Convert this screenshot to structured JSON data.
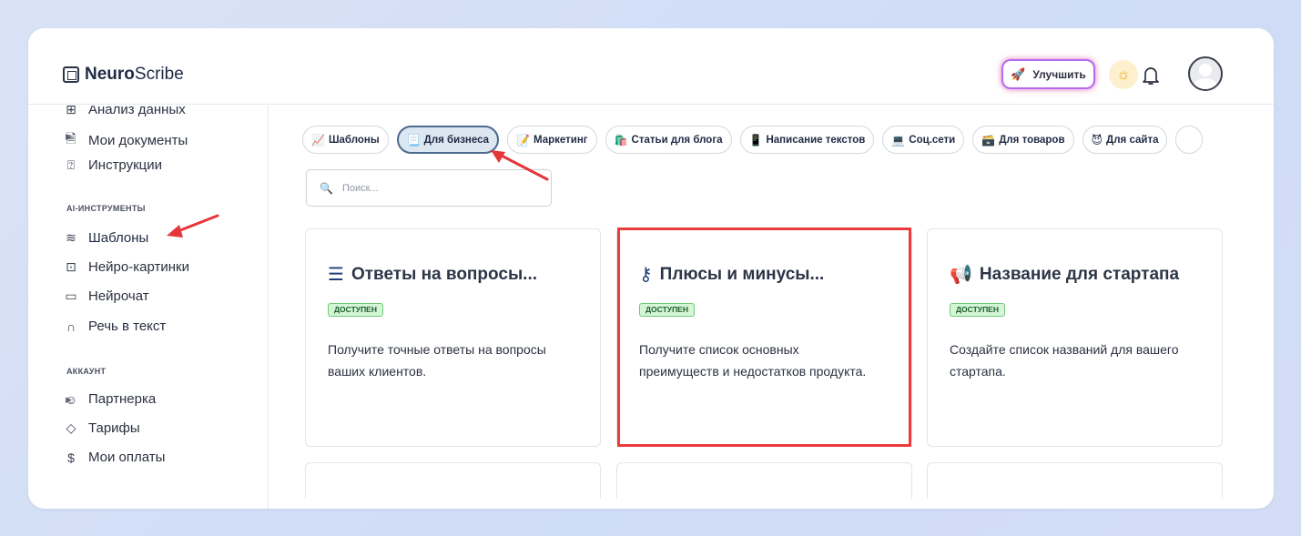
{
  "app": {
    "logo_bold": "Neuro",
    "logo_rest": "Scribe"
  },
  "header": {
    "upgrade_label": "Улучшить"
  },
  "sidebar": {
    "items_top": [
      {
        "label": "Анализ данных",
        "icon": "grid-icon"
      },
      {
        "label": "Мои документы",
        "icon": "document-icon"
      },
      {
        "label": "Инструкции",
        "icon": "help-circle-icon"
      }
    ],
    "section_ai": "AI-ИНСТРУМЕНТЫ",
    "items_ai": [
      {
        "label": "Шаблоны",
        "icon": "layers-icon"
      },
      {
        "label": "Нейро-картинки",
        "icon": "image-icon"
      },
      {
        "label": "Нейрочат",
        "icon": "chat-icon"
      },
      {
        "label": "Речь в текст",
        "icon": "headphones-icon"
      }
    ],
    "section_account": "АККАУНТ",
    "items_account": [
      {
        "label": "Партнерка",
        "icon": "users-icon"
      },
      {
        "label": "Тарифы",
        "icon": "tag-icon"
      },
      {
        "label": "Мои оплаты",
        "icon": "dollar-icon"
      }
    ]
  },
  "tabs": [
    {
      "label": "Шаблоны",
      "emoji": "📈"
    },
    {
      "label": "Для бизнеса",
      "emoji": "📃"
    },
    {
      "label": "Маркетинг",
      "emoji": "📝"
    },
    {
      "label": "Статьи для блога",
      "emoji": "🛍️"
    },
    {
      "label": "Написание текстов",
      "emoji": "📱"
    },
    {
      "label": "Соц.сети",
      "emoji": "💻"
    },
    {
      "label": "Для товаров",
      "emoji": "🗃️"
    },
    {
      "label": "Для сайта",
      "emoji": "😈"
    }
  ],
  "search": {
    "placeholder": "Поиск..."
  },
  "cards": [
    {
      "title": "Ответы на вопросы...",
      "icon": "list-icon",
      "badge": "ДОСТУПЕН",
      "description": "Получите точные ответы на вопросы ваших клиентов."
    },
    {
      "title": "Плюсы и минусы...",
      "icon": "key-icon",
      "badge": "ДОСТУПЕН",
      "description": "Получите список основных преимуществ и недостатков продукта."
    },
    {
      "title": "Название для стартапа",
      "icon": "megaphone-icon",
      "badge": "ДОСТУПЕН",
      "description": "Создайте список названий для вашего стартапа."
    }
  ],
  "colors": {
    "accent": "#4c6a8e",
    "highlight": "#ec3b3b",
    "badge_bg": "#d4f5d6"
  }
}
